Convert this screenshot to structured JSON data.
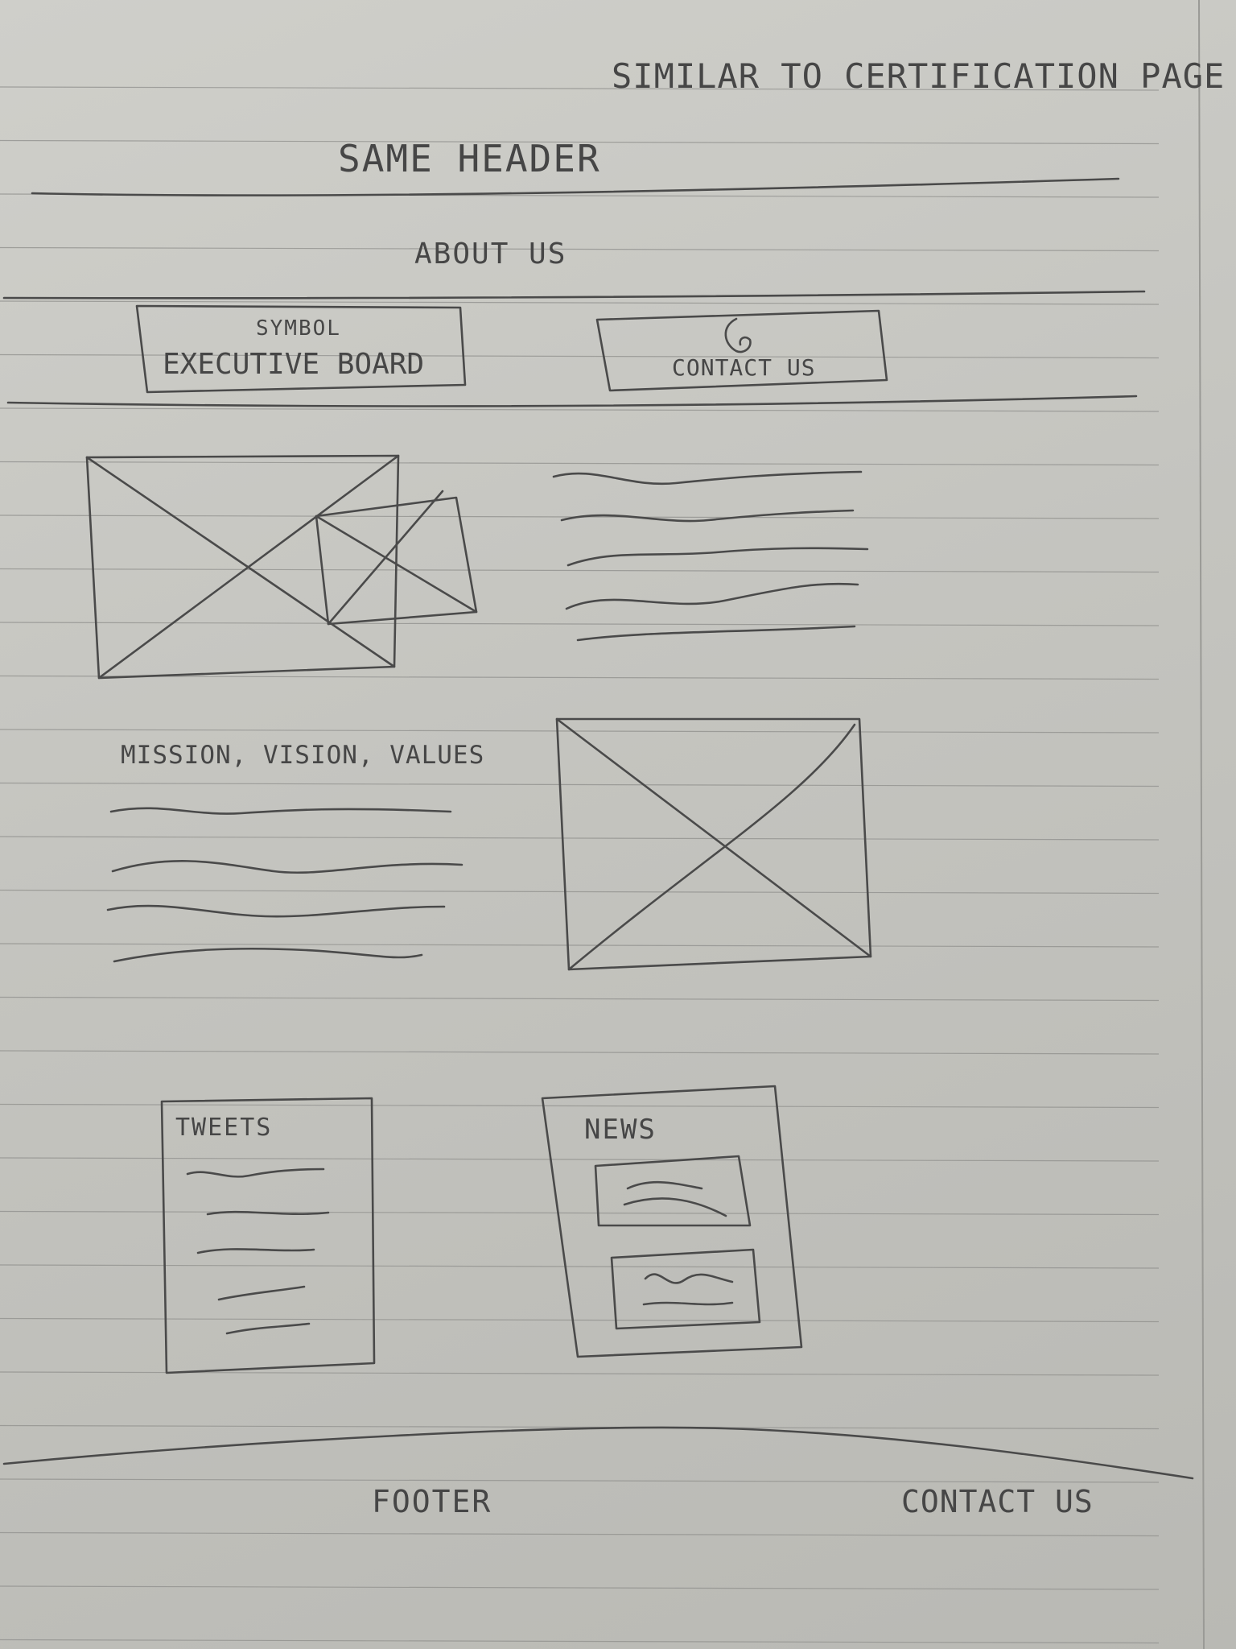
{
  "sketch": {
    "top_note": "SIMILAR TO CERTIFICATION PAGE",
    "header": "SAME HEADER",
    "page_title": "ABOUT US",
    "buttons": {
      "executive_board": {
        "icon_caption": "SYMBOL",
        "label": "EXECUTIVE BOARD"
      },
      "contact_us": {
        "icon": "phone-icon",
        "label": "CONTACT US"
      }
    },
    "mission": {
      "heading": "MISSION, VISION, VALUES"
    },
    "tweets": {
      "heading": "TWEETS"
    },
    "news": {
      "heading": "NEWS"
    },
    "footer": {
      "label": "FOOTER",
      "contact": "CONTACT US"
    }
  },
  "colors": {
    "paper": "#c9c9c4",
    "rule_line": "#8f8f8c",
    "pencil": "#4a4a4a"
  }
}
